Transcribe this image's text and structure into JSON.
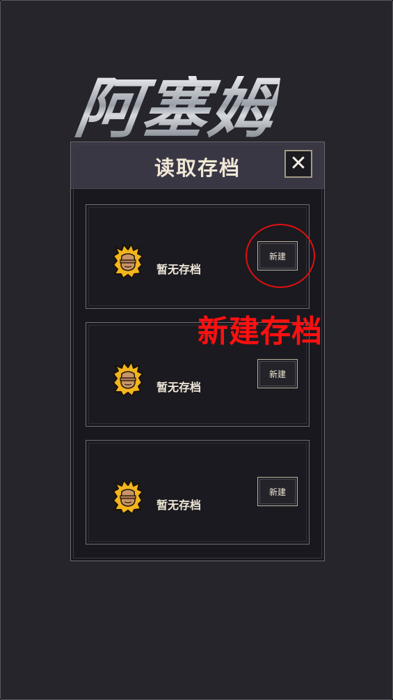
{
  "game": {
    "title": "阿塞姆"
  },
  "dialog": {
    "title": "读取存档",
    "close_icon": "close-icon",
    "close_glyph": "✕"
  },
  "slots": [
    {
      "label": "暂无存档",
      "button_label": "新建",
      "avatar_icon": "golden-monkey-avatar-icon"
    },
    {
      "label": "暂无存档",
      "button_label": "新建",
      "avatar_icon": "golden-monkey-avatar-icon"
    },
    {
      "label": "暂无存档",
      "button_label": "新建",
      "avatar_icon": "golden-monkey-avatar-icon"
    }
  ],
  "annotation": {
    "text": "新建存档",
    "color": "#ff1010"
  },
  "colors": {
    "background": "#26252b",
    "panel": "#19181f",
    "header": "#3a3745",
    "text": "#f0e8d6",
    "avatar_gold": "#f2b51d",
    "avatar_face": "#c99466"
  }
}
